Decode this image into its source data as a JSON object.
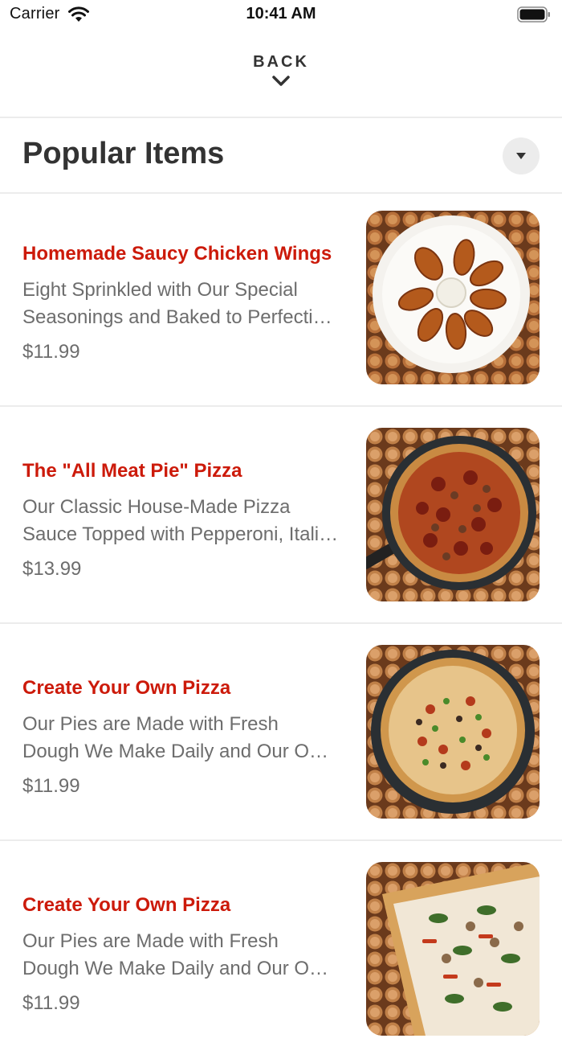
{
  "status_bar": {
    "carrier": "Carrier",
    "time": "10:41 AM"
  },
  "nav": {
    "back_label": "BACK"
  },
  "section": {
    "title": "Popular Items"
  },
  "items": [
    {
      "name": "Homemade Saucy Chicken Wings",
      "desc_line1": "Eight Sprinkled with Our Special",
      "desc_line2": "Seasonings and Baked to Perfecti…",
      "price": "$11.99",
      "image": "chicken-wings-photo"
    },
    {
      "name": "The \"All Meat Pie\" Pizza",
      "desc_line1": "Our Classic House-Made Pizza",
      "desc_line2": "Sauce Topped with Pepperoni, Itali…",
      "price": "$13.99",
      "image": "meat-pizza-photo"
    },
    {
      "name": "Create Your Own Pizza",
      "desc_line1": "Our Pies are Made with Fresh",
      "desc_line2": "Dough We Make Daily and Our O…",
      "price": "$11.99",
      "image": "veggie-pizza-photo"
    },
    {
      "name": "Create Your Own Pizza",
      "desc_line1": "Our Pies are Made with Fresh",
      "desc_line2": "Dough We Make Daily and Our O…",
      "price": "$11.99",
      "image": "spinach-pizza-photo"
    }
  ],
  "colors": {
    "item_name": "#cc1a0a",
    "text_muted": "#6d6d6d",
    "divider": "#ececec"
  }
}
